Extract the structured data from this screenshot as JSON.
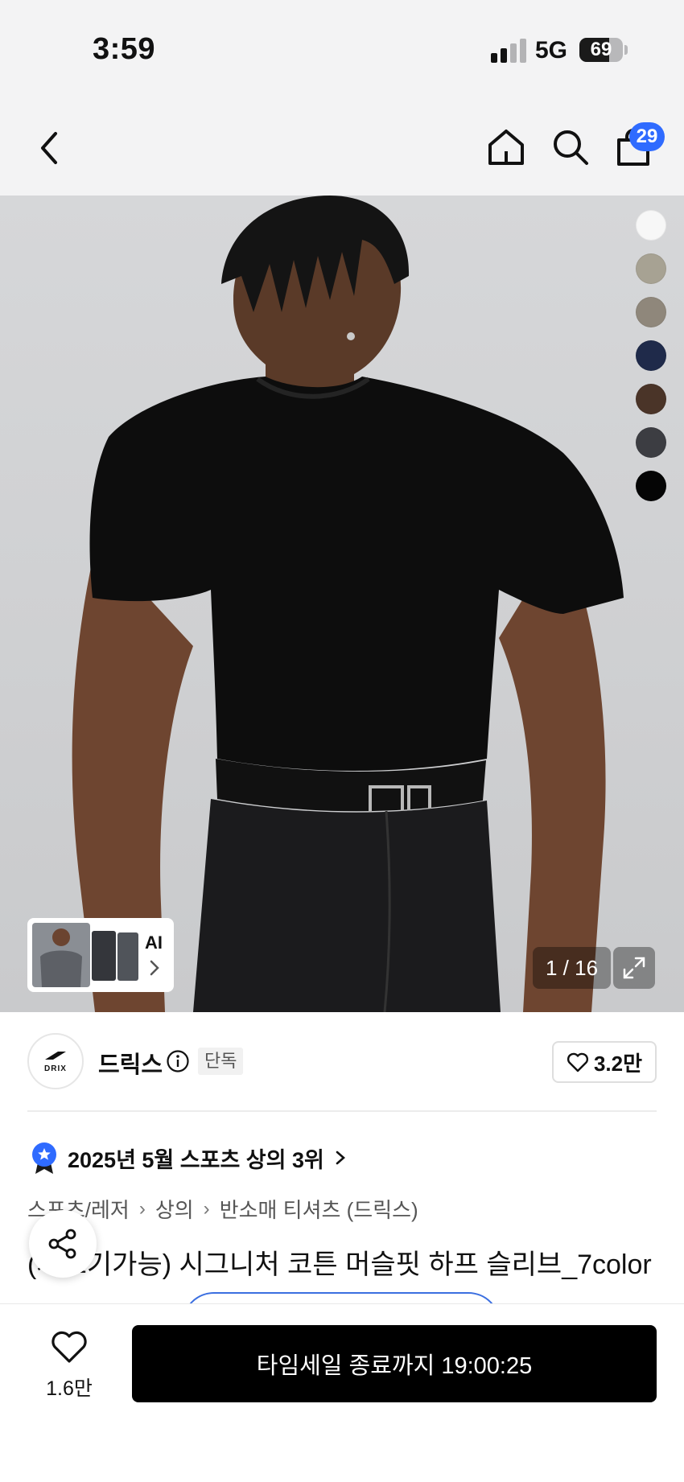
{
  "status_bar": {
    "time": "3:59",
    "network": "5G",
    "battery": "69",
    "battery_level": 0.69
  },
  "nav": {
    "cart_badge": "29"
  },
  "gallery": {
    "color_swatches": [
      "#f7f7f7",
      "#a7a293",
      "#8f877b",
      "#1f2a4a",
      "#4a3428",
      "#3c3d42",
      "#050505"
    ],
    "ai_label": "AI",
    "page_counter": "1 / 16"
  },
  "brand": {
    "logo_text": "DRIX",
    "name": "드릭스",
    "exclusive_badge": "단독",
    "likes": "3.2만"
  },
  "ranking": {
    "text": "2025년 5월 스포츠 상의 3위",
    "badge_color": "#2f6bff"
  },
  "breadcrumb": [
    "스포츠/레저",
    "상의",
    "반소매 티셔츠 (드릭스)"
  ],
  "product": {
    "title": "(세트기가능) 시그니처 코튼 머슬핏 하프 슬리브_7color"
  },
  "bottom_bar": {
    "wishlist_count": "1.6만",
    "buy_label": "타임세일 종료까지 19:00:25"
  }
}
